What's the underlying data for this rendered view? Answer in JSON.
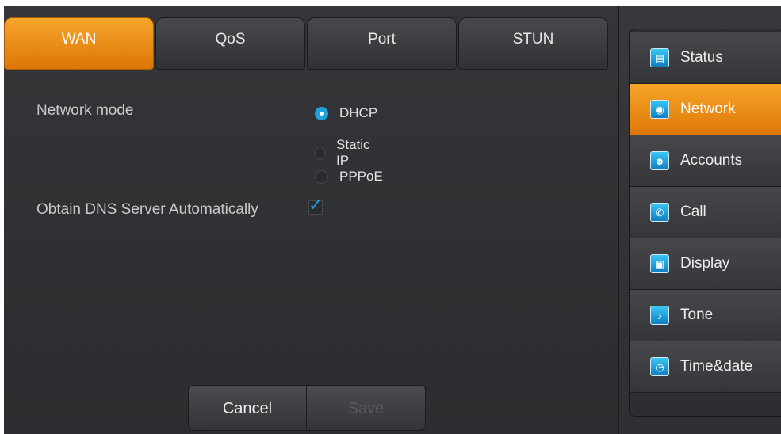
{
  "tabs": [
    {
      "label": "WAN",
      "active": true
    },
    {
      "label": "QoS",
      "active": false
    },
    {
      "label": "Port",
      "active": false
    },
    {
      "label": "STUN",
      "active": false
    }
  ],
  "form": {
    "network_mode_label": "Network mode",
    "network_mode_options": [
      {
        "label": "DHCP",
        "selected": true
      },
      {
        "label": "Static IP",
        "selected": false
      },
      {
        "label": "PPPoE",
        "selected": false
      }
    ],
    "dns_auto_label": "Obtain DNS Server Automatically",
    "dns_auto_checked": true
  },
  "buttons": {
    "cancel_label": "Cancel",
    "save_label": "Save"
  },
  "sidebar": {
    "items": [
      {
        "label": "Status",
        "icon": "status-icon",
        "active": false
      },
      {
        "label": "Network",
        "icon": "network-globe-icon",
        "active": true
      },
      {
        "label": "Accounts",
        "icon": "accounts-icon",
        "active": false
      },
      {
        "label": "Call",
        "icon": "call-phone-icon",
        "active": false
      },
      {
        "label": "Display",
        "icon": "display-monitor-icon",
        "active": false
      },
      {
        "label": "Tone",
        "icon": "tone-speaker-icon",
        "active": false
      },
      {
        "label": "Time&date",
        "icon": "clock-icon",
        "active": false
      }
    ]
  },
  "colors": {
    "accent_orange": "#f09618",
    "accent_blue": "#1ea1dc",
    "panel_dark": "#303235"
  }
}
